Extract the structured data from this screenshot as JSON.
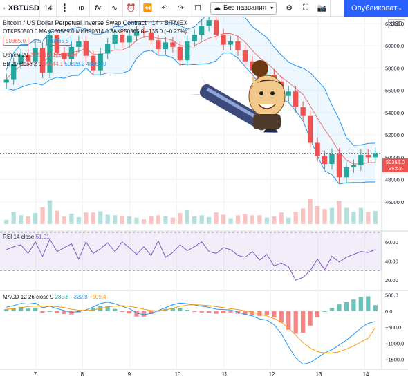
{
  "toolbar": {
    "symbol": "XBTUSD",
    "interval": "14",
    "sheet_name": "Без названия",
    "publish": "Опубликовать",
    "icons": [
      "candles-icon",
      "add-circle-icon",
      "indicators-icon",
      "waveform-icon",
      "alert-clock-icon",
      "replay-icon",
      "undo-icon",
      "redo-icon",
      "layout-icon",
      "cloud-icon",
      "settings-icon",
      "fullscreen-icon",
      "camera-icon"
    ]
  },
  "legend": {
    "title": "Bitcoin / US Dollar Perpetual Inverse Swap Contract · 14 · BITMEX",
    "ohlc": "ОТКР50500.0 МАКС50569.0 МИН50314.0 ЗАКР50365.0 −135.0 (−0.27%)",
    "price_a": "50365.0",
    "spread": "0.5",
    "price_b": "50365.5",
    "volume_label": "Объём 20",
    "volume_a": "23.541M",
    "volume_b": "123.944M",
    "bb_label": "BB 20 close 2 0",
    "bb_a": "49444.1",
    "bb_b": "50828.2",
    "bb_c": "48060.0",
    "rsi_label": "RSI 14 close",
    "rsi_value": "51.91",
    "macd_label": "MACD 12 26 close 9",
    "macd_a": "285.6",
    "macd_b": "−322.8",
    "macd_c": "−509.4"
  },
  "price_axis": {
    "currency": "USD",
    "last_price": "50365.0",
    "countdown": "36:53"
  },
  "colors": {
    "up": "#26a69a",
    "down": "#ef5350",
    "bb": "#2196f3",
    "bb_basis": "#e57373",
    "rsi": "#7e57c2",
    "macd": "#2196f3",
    "signal": "#ff9800",
    "grid": "#f0f3fa"
  },
  "chart_data": [
    {
      "type": "line",
      "name": "price",
      "ylim": [
        44000,
        62000
      ],
      "yticks": [
        46000,
        48000,
        50000,
        52000,
        54000,
        56000,
        58000,
        60000,
        62000
      ],
      "x": [
        "7",
        "8",
        "9",
        "10",
        "11",
        "12",
        "13",
        "14"
      ],
      "close": [
        57000,
        58400,
        59200,
        58600,
        59800,
        57600,
        61000,
        59400,
        58800,
        59900,
        60400,
        59100,
        57800,
        59300,
        60200,
        61000,
        60300,
        60900,
        61300,
        61200,
        60500,
        59700,
        60300,
        59900,
        58700,
        60400,
        61000,
        61800,
        62300,
        61000,
        60100,
        60400,
        59600,
        58600,
        57800,
        57000,
        57400,
        56800,
        55500,
        55900,
        54500,
        53700,
        51300,
        50100,
        49400,
        50300,
        48200,
        49100,
        49300,
        50200,
        50000,
        50365
      ]
    },
    {
      "type": "line",
      "name": "RSI 14 close",
      "ylim": [
        10,
        70
      ],
      "yticks": [
        20,
        40,
        60
      ],
      "bands": [
        30,
        70
      ],
      "values": [
        52,
        55,
        57,
        48,
        60,
        45,
        63,
        50,
        54,
        58,
        42,
        60,
        48,
        53,
        59,
        50,
        60,
        54,
        47,
        55,
        46,
        61,
        44,
        49,
        57,
        51,
        55,
        60,
        50,
        48,
        54,
        52,
        46,
        44,
        50,
        41,
        47,
        35,
        38,
        34,
        20,
        23,
        30,
        42,
        31,
        45,
        39,
        44,
        47,
        50,
        49,
        52
      ]
    },
    {
      "type": "bar",
      "name": "MACD 12 26 close 9",
      "ylim": [
        -1700,
        600
      ],
      "yticks": [
        -1500,
        -1000,
        -500,
        0,
        500
      ],
      "macd": [
        120,
        170,
        240,
        220,
        250,
        110,
        150,
        80,
        20,
        -40,
        -10,
        40,
        130,
        240,
        280,
        230,
        150,
        80,
        -60,
        -110,
        -70,
        20,
        110,
        200,
        250,
        230,
        190,
        150,
        120,
        60,
        50,
        40,
        -30,
        -100,
        -150,
        -240,
        -280,
        -420,
        -700,
        -1100,
        -1450,
        -1650,
        -1600,
        -1450,
        -1300,
        -1200,
        -1050,
        -900,
        -720,
        -520,
        -380,
        -323
      ],
      "signal": [
        60,
        80,
        110,
        140,
        160,
        160,
        150,
        140,
        110,
        60,
        30,
        20,
        40,
        80,
        130,
        160,
        170,
        150,
        110,
        60,
        20,
        10,
        40,
        90,
        150,
        190,
        200,
        190,
        170,
        140,
        110,
        80,
        50,
        10,
        -30,
        -90,
        -150,
        -230,
        -350,
        -520,
        -750,
        -980,
        -1150,
        -1260,
        -1300,
        -1300,
        -1260,
        -1180,
        -1080,
        -960,
        -840,
        -509
      ]
    }
  ]
}
